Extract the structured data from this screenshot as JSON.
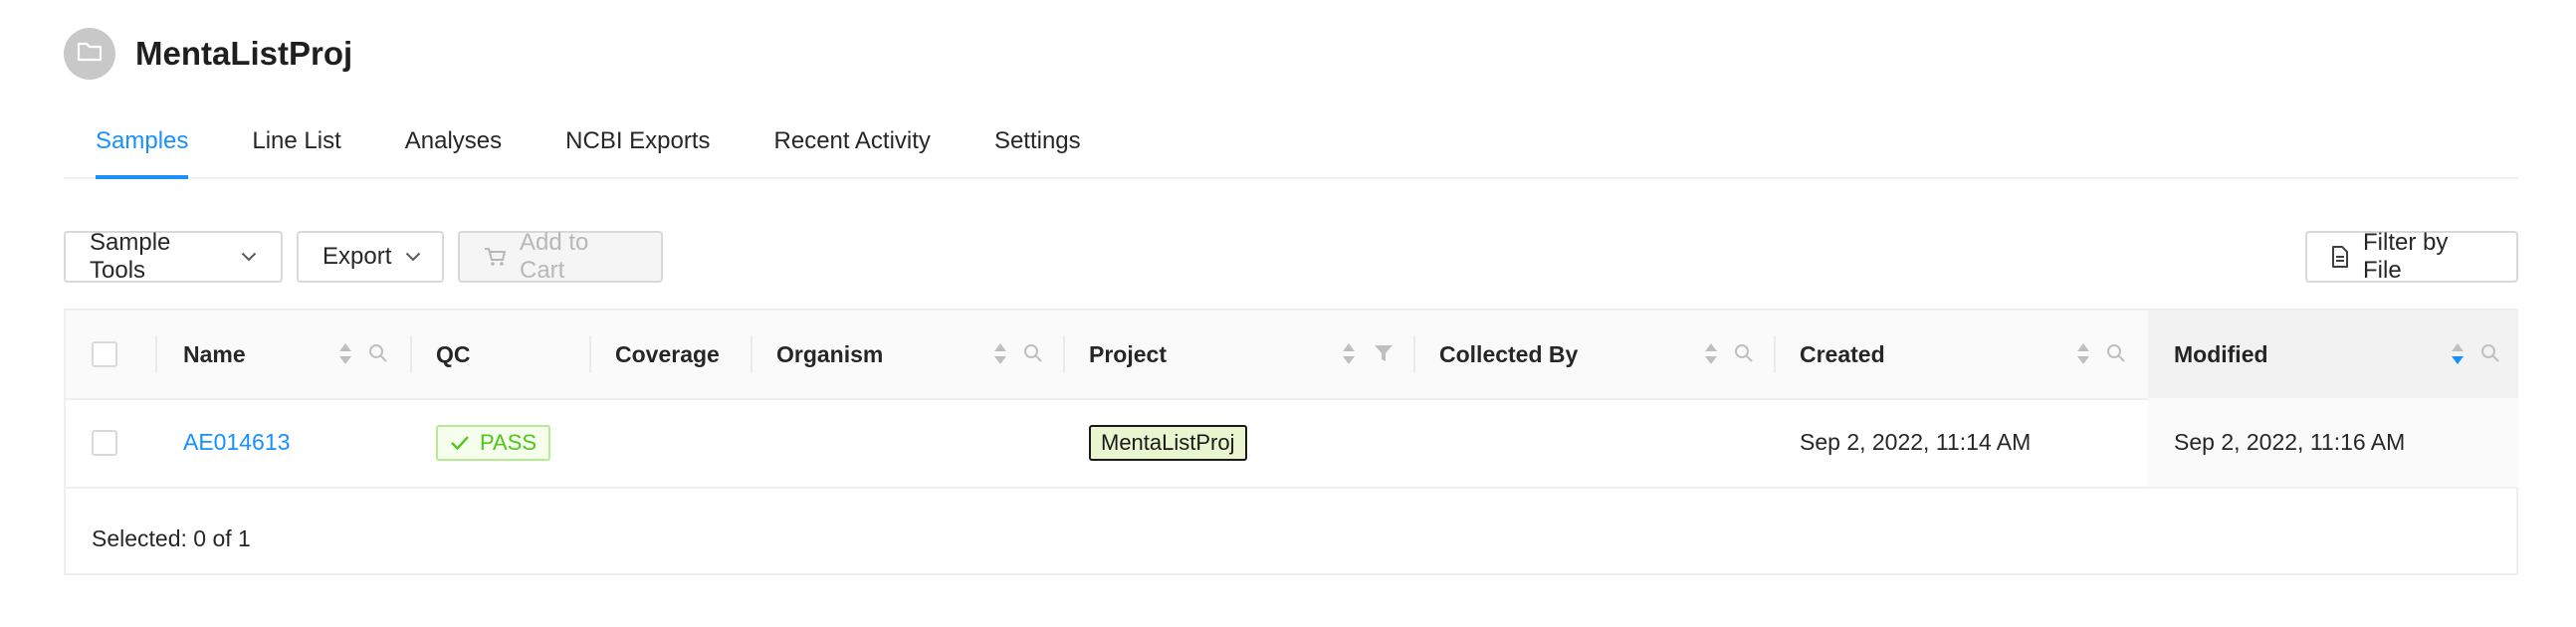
{
  "project": {
    "title": "MentaListProj",
    "icon": "folder-icon"
  },
  "tabs": [
    {
      "label": "Samples",
      "active": true
    },
    {
      "label": "Line List",
      "active": false
    },
    {
      "label": "Analyses",
      "active": false
    },
    {
      "label": "NCBI Exports",
      "active": false
    },
    {
      "label": "Recent Activity",
      "active": false
    },
    {
      "label": "Settings",
      "active": false
    }
  ],
  "toolbar": {
    "sample_tools_label": "Sample Tools",
    "export_label": "Export",
    "add_to_cart_label": "Add to Cart",
    "filter_by_file_label": "Filter by File"
  },
  "table": {
    "columns": {
      "name": "Name",
      "qc": "QC",
      "coverage": "Coverage",
      "organism": "Organism",
      "project": "Project",
      "collected_by": "Collected By",
      "created": "Created",
      "modified": "Modified"
    },
    "rows": [
      {
        "name": "AE014613",
        "qc": "PASS",
        "coverage": "",
        "organism": "",
        "project": "MentaListProj",
        "collected_by": "",
        "created": "Sep 2, 2022, 11:14 AM",
        "modified": "Sep 2, 2022, 11:16 AM"
      }
    ],
    "selection_summary": "Selected: 0 of 1"
  },
  "colors": {
    "accent": "#1890ff",
    "qc_pass": "#52c41a",
    "project_tag_bg": "#e8f5cf"
  }
}
